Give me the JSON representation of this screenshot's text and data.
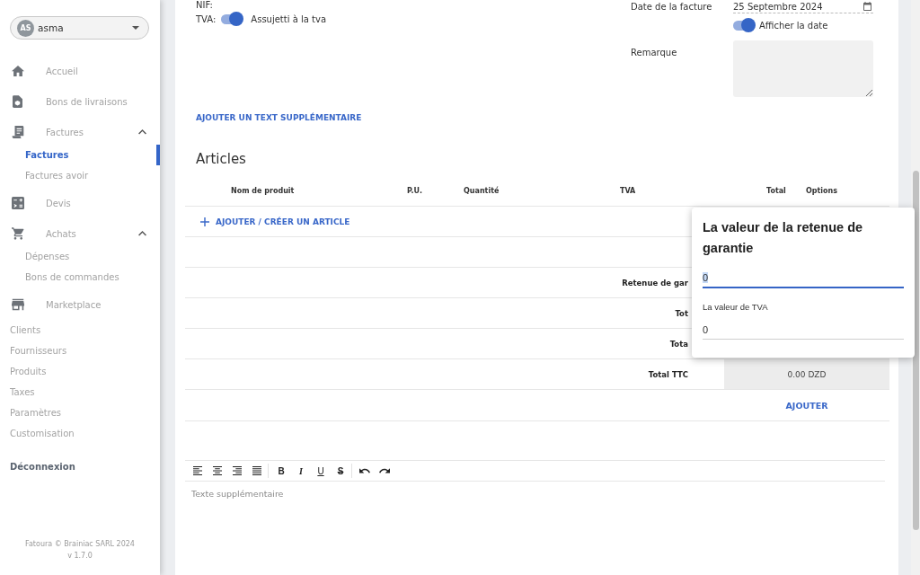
{
  "sidebar": {
    "user": {
      "initials": "AS",
      "name": "asma"
    },
    "nav": [
      {
        "kind": "icon",
        "label": "Accueil",
        "selected": false
      },
      {
        "kind": "icon",
        "label": "Bons de livraisons",
        "selected": false
      },
      {
        "kind": "icon",
        "label": "Factures",
        "selected": false,
        "expanded": true,
        "children": [
          {
            "label": "Factures",
            "selected": true
          },
          {
            "label": "Factures avoir",
            "selected": false
          }
        ]
      },
      {
        "kind": "icon",
        "label": "Devis",
        "selected": false
      },
      {
        "kind": "icon",
        "label": "Achats",
        "selected": false,
        "expanded": true,
        "children": [
          {
            "label": "Dépenses",
            "selected": false
          },
          {
            "label": "Bons de commandes",
            "selected": false
          }
        ]
      },
      {
        "kind": "icon",
        "label": "Marketplace",
        "selected": false
      },
      {
        "kind": "plain",
        "label": "Clients",
        "selected": false
      },
      {
        "kind": "plain",
        "label": "Fournisseurs",
        "selected": false
      },
      {
        "kind": "plain",
        "label": "Produits",
        "selected": false
      },
      {
        "kind": "plain",
        "label": "Taxes",
        "selected": false
      },
      {
        "kind": "plain",
        "label": "Paramètres",
        "selected": false
      },
      {
        "kind": "plain",
        "label": "Customisation",
        "selected": false
      },
      {
        "kind": "logout",
        "label": "Déconnexion",
        "selected": false
      }
    ],
    "footer": {
      "copyright": "Fatoura © Brainiac SARL 2024",
      "version": "v 1.7.0"
    }
  },
  "invoice": {
    "nif_label": "NIF:",
    "tva": {
      "label": "TVA:",
      "on": true,
      "text": "Assujetti à la tva"
    },
    "date": {
      "label": "Date de la facture",
      "value": "25 Septembre 2024"
    },
    "show_date": {
      "on": true,
      "text": "Afficher la date"
    },
    "remark": {
      "label": "Remarque"
    }
  },
  "add_text_link": "AJOUTER UN TEXT SUPPLÉMENTAIRE",
  "articles": {
    "title": "Articles",
    "columns": [
      "Nom de produit",
      "P.U.",
      "Quantité",
      "TVA",
      "Total",
      "Options"
    ],
    "add_button": "AJOUTER / CRÉER UN ARTICLE",
    "summary": [
      {
        "label": "Retenue de gar"
      },
      {
        "label": "Tot"
      },
      {
        "label": "Tota"
      },
      {
        "label": "Total TTC",
        "value": "0.00 DZD"
      }
    ],
    "submit_button": "AJOUTER"
  },
  "popover": {
    "title": "La valeur de la retenue de garantie",
    "fields": [
      {
        "value": "0",
        "focused": true
      },
      {
        "label": "La valeur de TVA",
        "value": "0",
        "focused": false
      }
    ]
  },
  "editor": {
    "toolbar": [
      [
        {
          "kind": "icon"
        },
        {
          "kind": "icon"
        },
        {
          "kind": "icon"
        },
        {
          "kind": "icon"
        }
      ],
      [
        {
          "kind": "bold",
          "label": "B"
        },
        {
          "kind": "italic",
          "label": "I"
        },
        {
          "kind": "underline",
          "label": "U"
        },
        {
          "kind": "strike",
          "label": "S"
        }
      ],
      [
        {
          "kind": "icon"
        },
        {
          "kind": "icon"
        }
      ]
    ],
    "placeholder": "Texte supplémentaire"
  }
}
